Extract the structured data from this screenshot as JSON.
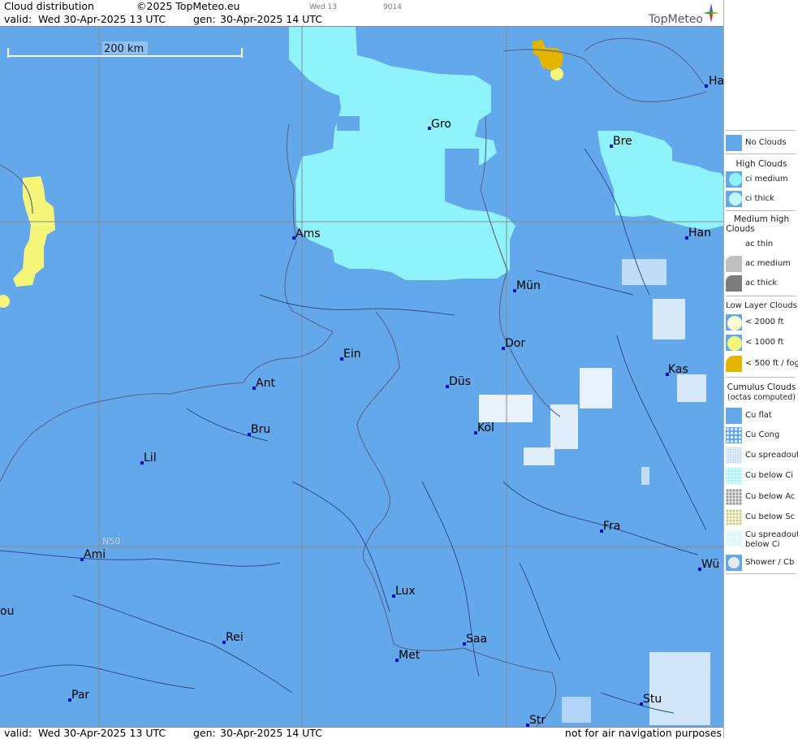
{
  "header": {
    "title": "Cloud distribution",
    "copyright": "©2025 TopMeteo.eu",
    "valid_label": "valid:",
    "valid_value": "Wed  30-Apr-2025  13 UTC",
    "gen_label": "gen:",
    "gen_value": "30-Apr-2025 14 UTC",
    "small_day": "Wed 13",
    "small_code": "9014",
    "brand": "TopMeteo"
  },
  "footer": {
    "valid_label": "valid:",
    "valid_value": "Wed  30-Apr-2025  13 UTC",
    "gen_label": "gen:",
    "gen_value": "30-Apr-2025 14 UTC",
    "disclaimer": "not for air navigation purposes"
  },
  "map": {
    "scale_label": "200 km",
    "lat_label": "N50",
    "colors": {
      "background": "#64a8ec",
      "ci_medium": "#8ef3fb",
      "low_1000": "#f5f57a",
      "low_500": "#e4b400",
      "grid": "#8a8a8a",
      "rivers": "#2c4f8c",
      "borders": "#6a6a8a",
      "cu_dots": "#ffffff"
    },
    "cities": [
      {
        "name": "Gro"
      },
      {
        "name": "Bre"
      },
      {
        "name": "Ha"
      },
      {
        "name": "Ams"
      },
      {
        "name": "Han"
      },
      {
        "name": "Mün"
      },
      {
        "name": "Dor"
      },
      {
        "name": "Ein"
      },
      {
        "name": "Ant"
      },
      {
        "name": "Düs"
      },
      {
        "name": "Kas"
      },
      {
        "name": "Bru"
      },
      {
        "name": "Köl"
      },
      {
        "name": "Lil"
      },
      {
        "name": "Fra"
      },
      {
        "name": "Ami"
      },
      {
        "name": "Wü"
      },
      {
        "name": "Lux"
      },
      {
        "name": "ou"
      },
      {
        "name": "Rei"
      },
      {
        "name": "Saa"
      },
      {
        "name": "Met"
      },
      {
        "name": "Par"
      },
      {
        "name": "Stu"
      },
      {
        "name": "Str"
      }
    ]
  },
  "legend": {
    "no_clouds": "No Clouds",
    "high_clouds": "High Clouds",
    "ci_medium": "ci medium",
    "ci_thick": "ci thick",
    "medium_high_clouds_1": "Medium high",
    "medium_high_clouds_2": "Clouds",
    "ac_thin": "ac thin",
    "ac_medium": "ac medium",
    "ac_thick": "ac thick",
    "low_layer_clouds": "Low Layer Clouds",
    "lt_2000": "< 2000 ft",
    "lt_1000": "< 1000 ft",
    "lt_500": "< 500 ft / fog",
    "cumulus_clouds": "Cumulus Clouds",
    "octas_computed": "(octas computed)",
    "cu_flat": "Cu flat",
    "cu_cong": "Cu Cong",
    "cu_spreadout": "Cu spreadout",
    "cu_below_ci": "Cu below Ci",
    "cu_below_ac": "Cu below Ac",
    "cu_below_sc": "Cu below Sc",
    "cu_spreadout_below_ci_1": "Cu spreadout",
    "cu_spreadout_below_ci_2": "below Ci",
    "shower_cb": "Shower / Cb"
  }
}
